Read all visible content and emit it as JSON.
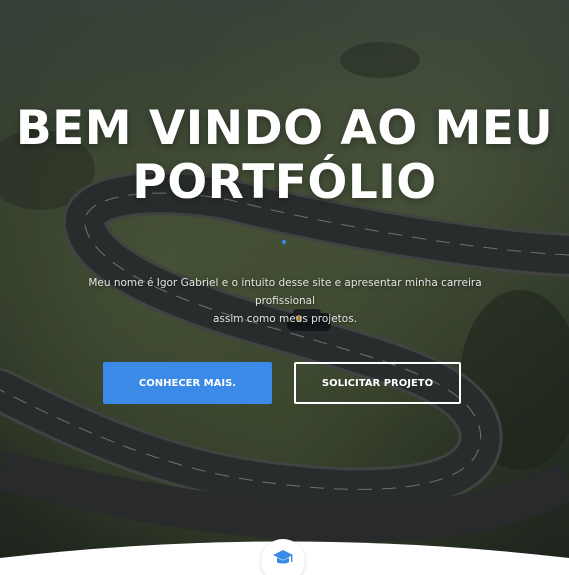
{
  "hero": {
    "title_line1": "BEM VINDO AO MEU",
    "title_line2": "PORTFÓLIO",
    "description_line1": "Meu nome é Igor Gabriel e o intuito desse site e apresentar minha carreira profissional",
    "description_line2": "assim como meus projetos.",
    "primary_button": "CONHECER MAIS.",
    "secondary_button": "SOLICITAR PROJETO"
  },
  "icons": {
    "section_icon": "graduation-cap-icon",
    "divider": "dot"
  },
  "colors": {
    "accent": "#3b8ae8",
    "title_text": "#ffffff",
    "section_background": "#ffffff"
  }
}
